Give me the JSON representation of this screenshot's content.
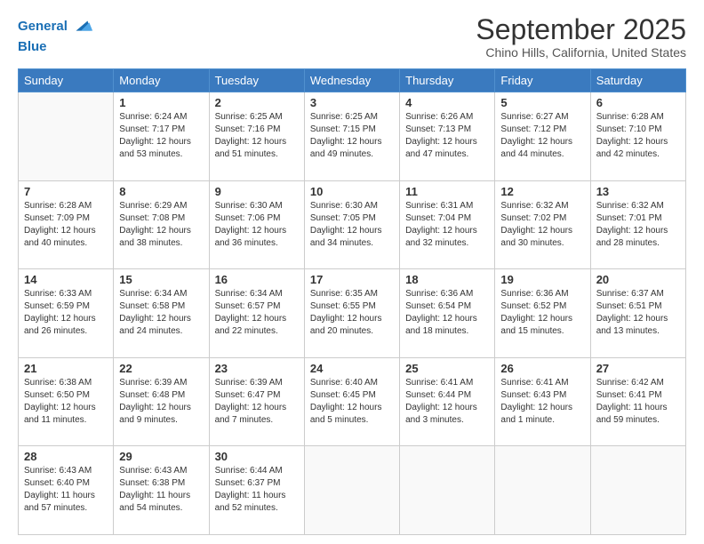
{
  "header": {
    "logo_line1": "General",
    "logo_line2": "Blue",
    "title": "September 2025",
    "subtitle": "Chino Hills, California, United States"
  },
  "weekdays": [
    "Sunday",
    "Monday",
    "Tuesday",
    "Wednesday",
    "Thursday",
    "Friday",
    "Saturday"
  ],
  "weeks": [
    [
      {
        "day": "",
        "info": ""
      },
      {
        "day": "1",
        "info": "Sunrise: 6:24 AM\nSunset: 7:17 PM\nDaylight: 12 hours\nand 53 minutes."
      },
      {
        "day": "2",
        "info": "Sunrise: 6:25 AM\nSunset: 7:16 PM\nDaylight: 12 hours\nand 51 minutes."
      },
      {
        "day": "3",
        "info": "Sunrise: 6:25 AM\nSunset: 7:15 PM\nDaylight: 12 hours\nand 49 minutes."
      },
      {
        "day": "4",
        "info": "Sunrise: 6:26 AM\nSunset: 7:13 PM\nDaylight: 12 hours\nand 47 minutes."
      },
      {
        "day": "5",
        "info": "Sunrise: 6:27 AM\nSunset: 7:12 PM\nDaylight: 12 hours\nand 44 minutes."
      },
      {
        "day": "6",
        "info": "Sunrise: 6:28 AM\nSunset: 7:10 PM\nDaylight: 12 hours\nand 42 minutes."
      }
    ],
    [
      {
        "day": "7",
        "info": "Sunrise: 6:28 AM\nSunset: 7:09 PM\nDaylight: 12 hours\nand 40 minutes."
      },
      {
        "day": "8",
        "info": "Sunrise: 6:29 AM\nSunset: 7:08 PM\nDaylight: 12 hours\nand 38 minutes."
      },
      {
        "day": "9",
        "info": "Sunrise: 6:30 AM\nSunset: 7:06 PM\nDaylight: 12 hours\nand 36 minutes."
      },
      {
        "day": "10",
        "info": "Sunrise: 6:30 AM\nSunset: 7:05 PM\nDaylight: 12 hours\nand 34 minutes."
      },
      {
        "day": "11",
        "info": "Sunrise: 6:31 AM\nSunset: 7:04 PM\nDaylight: 12 hours\nand 32 minutes."
      },
      {
        "day": "12",
        "info": "Sunrise: 6:32 AM\nSunset: 7:02 PM\nDaylight: 12 hours\nand 30 minutes."
      },
      {
        "day": "13",
        "info": "Sunrise: 6:32 AM\nSunset: 7:01 PM\nDaylight: 12 hours\nand 28 minutes."
      }
    ],
    [
      {
        "day": "14",
        "info": "Sunrise: 6:33 AM\nSunset: 6:59 PM\nDaylight: 12 hours\nand 26 minutes."
      },
      {
        "day": "15",
        "info": "Sunrise: 6:34 AM\nSunset: 6:58 PM\nDaylight: 12 hours\nand 24 minutes."
      },
      {
        "day": "16",
        "info": "Sunrise: 6:34 AM\nSunset: 6:57 PM\nDaylight: 12 hours\nand 22 minutes."
      },
      {
        "day": "17",
        "info": "Sunrise: 6:35 AM\nSunset: 6:55 PM\nDaylight: 12 hours\nand 20 minutes."
      },
      {
        "day": "18",
        "info": "Sunrise: 6:36 AM\nSunset: 6:54 PM\nDaylight: 12 hours\nand 18 minutes."
      },
      {
        "day": "19",
        "info": "Sunrise: 6:36 AM\nSunset: 6:52 PM\nDaylight: 12 hours\nand 15 minutes."
      },
      {
        "day": "20",
        "info": "Sunrise: 6:37 AM\nSunset: 6:51 PM\nDaylight: 12 hours\nand 13 minutes."
      }
    ],
    [
      {
        "day": "21",
        "info": "Sunrise: 6:38 AM\nSunset: 6:50 PM\nDaylight: 12 hours\nand 11 minutes."
      },
      {
        "day": "22",
        "info": "Sunrise: 6:39 AM\nSunset: 6:48 PM\nDaylight: 12 hours\nand 9 minutes."
      },
      {
        "day": "23",
        "info": "Sunrise: 6:39 AM\nSunset: 6:47 PM\nDaylight: 12 hours\nand 7 minutes."
      },
      {
        "day": "24",
        "info": "Sunrise: 6:40 AM\nSunset: 6:45 PM\nDaylight: 12 hours\nand 5 minutes."
      },
      {
        "day": "25",
        "info": "Sunrise: 6:41 AM\nSunset: 6:44 PM\nDaylight: 12 hours\nand 3 minutes."
      },
      {
        "day": "26",
        "info": "Sunrise: 6:41 AM\nSunset: 6:43 PM\nDaylight: 12 hours\nand 1 minute."
      },
      {
        "day": "27",
        "info": "Sunrise: 6:42 AM\nSunset: 6:41 PM\nDaylight: 11 hours\nand 59 minutes."
      }
    ],
    [
      {
        "day": "28",
        "info": "Sunrise: 6:43 AM\nSunset: 6:40 PM\nDaylight: 11 hours\nand 57 minutes."
      },
      {
        "day": "29",
        "info": "Sunrise: 6:43 AM\nSunset: 6:38 PM\nDaylight: 11 hours\nand 54 minutes."
      },
      {
        "day": "30",
        "info": "Sunrise: 6:44 AM\nSunset: 6:37 PM\nDaylight: 11 hours\nand 52 minutes."
      },
      {
        "day": "",
        "info": ""
      },
      {
        "day": "",
        "info": ""
      },
      {
        "day": "",
        "info": ""
      },
      {
        "day": "",
        "info": ""
      }
    ]
  ]
}
